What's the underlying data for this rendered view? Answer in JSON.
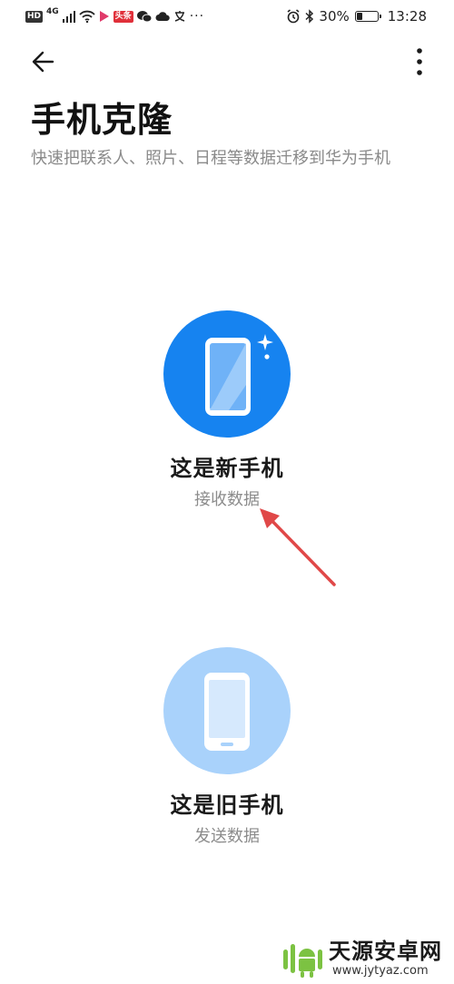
{
  "status_bar": {
    "left_badges": [
      "HD",
      "4G"
    ],
    "toutiao": "头条",
    "more": "···",
    "battery_percent": "30%",
    "battery_level": 0.3,
    "time": "13:28"
  },
  "header": {
    "back_icon": "arrow-left-icon",
    "menu_icon": "more-vertical-icon"
  },
  "page": {
    "title": "手机克隆",
    "subtitle": "快速把联系人、照片、日程等数据迁移到华为手机"
  },
  "options": [
    {
      "title": "这是新手机",
      "desc": "接收数据",
      "icon": "new-phone-icon",
      "color": "#1683f0"
    },
    {
      "title": "这是旧手机",
      "desc": "发送数据",
      "icon": "old-phone-icon",
      "color": "#a9d2fb"
    }
  ],
  "watermark": {
    "name": "天源安卓网",
    "url": "www.jytyaz.com"
  },
  "colors": {
    "accent": "#1683f0",
    "accent_light": "#a9d2fb",
    "annotation": "#e04848"
  }
}
